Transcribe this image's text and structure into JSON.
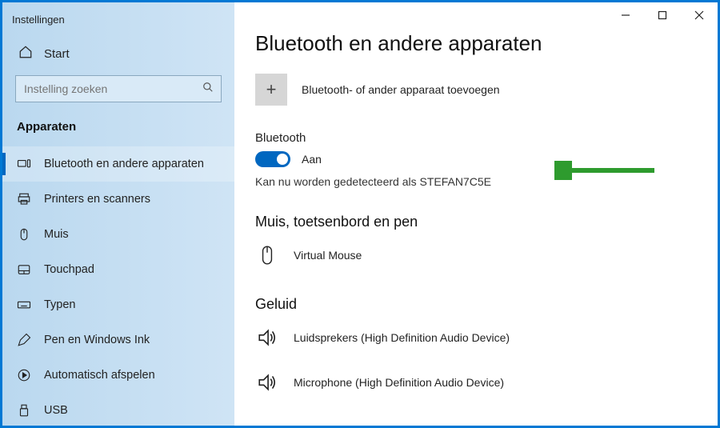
{
  "window": {
    "title": "Instellingen"
  },
  "home": {
    "label": "Start"
  },
  "search": {
    "placeholder": "Instelling zoeken"
  },
  "category": {
    "title": "Apparaten"
  },
  "nav": {
    "items": [
      {
        "label": "Bluetooth en andere apparaten"
      },
      {
        "label": "Printers en scanners"
      },
      {
        "label": "Muis"
      },
      {
        "label": "Touchpad"
      },
      {
        "label": "Typen"
      },
      {
        "label": "Pen en Windows Ink"
      },
      {
        "label": "Automatisch afspelen"
      },
      {
        "label": "USB"
      }
    ]
  },
  "page": {
    "title": "Bluetooth en andere apparaten",
    "add_label": "Bluetooth- of ander apparaat toevoegen",
    "bluetooth_label": "Bluetooth",
    "toggle_state": "Aan",
    "detect_text": "Kan nu worden gedetecteerd als STEFAN7C5E",
    "section_peripherals": "Muis, toetsenbord en pen",
    "device_mouse": "Virtual Mouse",
    "section_audio": "Geluid",
    "device_speakers": "Luidsprekers (High Definition Audio Device)",
    "device_mic": "Microphone (High Definition Audio Device)"
  }
}
